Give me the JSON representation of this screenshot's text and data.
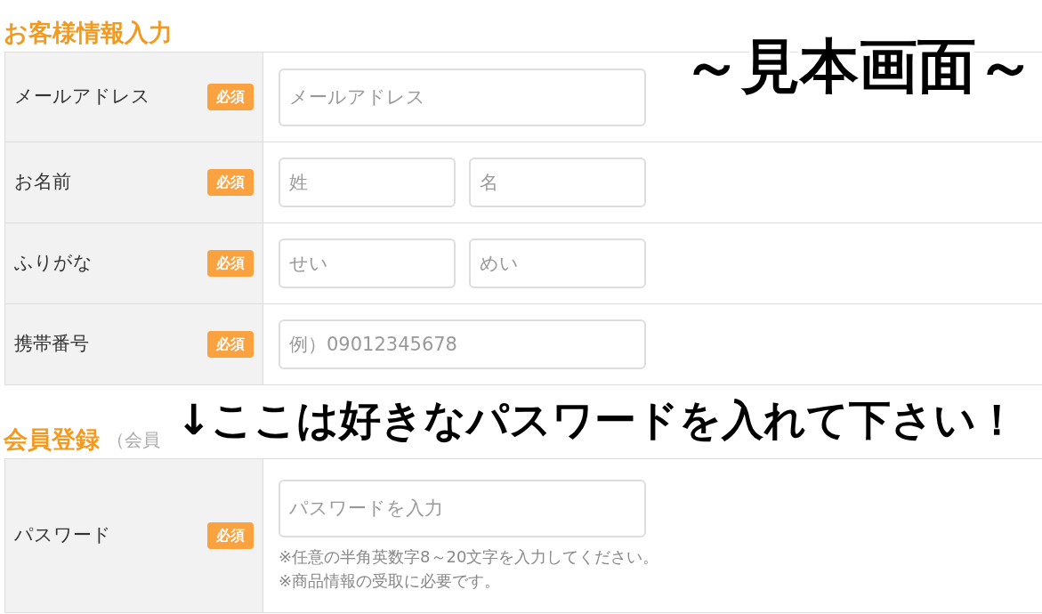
{
  "sections": [
    {
      "title": "お客様情報入力",
      "rows": [
        {
          "label": "メールアドレス",
          "badge": "必須",
          "fields": [
            {
              "placeholder": "メールアドレス",
              "kind": "wide"
            }
          ]
        },
        {
          "label": "お名前",
          "badge": "必須",
          "fields": [
            {
              "placeholder": "姓",
              "kind": "half"
            },
            {
              "placeholder": "名",
              "kind": "half"
            }
          ]
        },
        {
          "label": "ふりがな",
          "badge": "必須",
          "fields": [
            {
              "placeholder": "せい",
              "kind": "half"
            },
            {
              "placeholder": "めい",
              "kind": "half"
            }
          ]
        },
        {
          "label": "携帯番号",
          "badge": "必須",
          "fields": [
            {
              "placeholder": "例）09012345678",
              "kind": "wide"
            }
          ]
        }
      ]
    },
    {
      "title": "会員登録",
      "subtitle": "（会員",
      "rows": [
        {
          "label": "パスワード",
          "badge": "必須",
          "fields": [
            {
              "placeholder": "パスワードを入力",
              "kind": "wide"
            }
          ],
          "notes": [
            "※任意の半角英数字8～20文字を入力してください。",
            "※商品情報の受取に必要です。"
          ]
        }
      ]
    }
  ],
  "overlays": [
    {
      "kind": "caption",
      "text": "～見本画面～"
    },
    {
      "kind": "banner",
      "text": "↓ここは好きなパスワードを入れて下さい！"
    }
  ]
}
